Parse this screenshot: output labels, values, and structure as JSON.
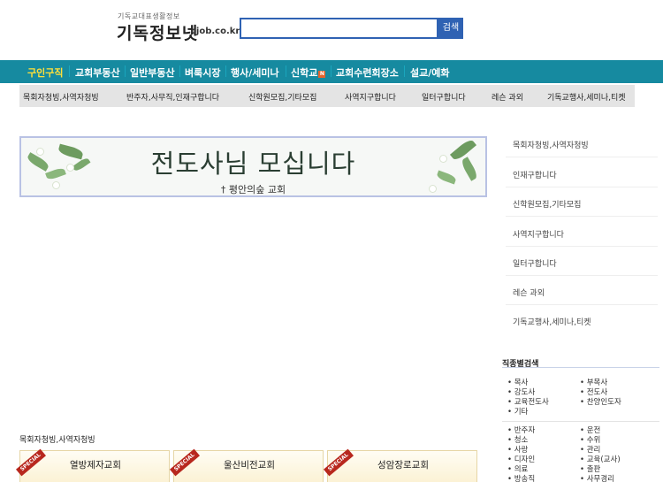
{
  "header": {
    "tagline": "기독교대표생활정보",
    "logo": "기독정보넷",
    "domain": "cjob.co.kr",
    "search": {
      "value": "",
      "button": "검색"
    }
  },
  "nav": {
    "items": [
      {
        "label": "구인구직",
        "active": true
      },
      {
        "label": "교회부동산"
      },
      {
        "label": "일반부동산"
      },
      {
        "label": "벼룩시장"
      },
      {
        "label": "행사/세미나"
      },
      {
        "label": "신학교",
        "badge": "N"
      },
      {
        "label": "교회수련회장소"
      },
      {
        "label": "설교/예화"
      }
    ]
  },
  "subnav": {
    "items": [
      "목회자청빙,사역자청빙",
      "반주자,사무직,인재구합니다",
      "신학원모집,기타모집",
      "사역지구합니다",
      "일터구합니다",
      "레슨 과외",
      "기독교행사,세미나,티켓"
    ]
  },
  "banner": {
    "title": "전도사님 모십니다",
    "subtitle": "† 평안의숲 교회"
  },
  "sidebar": {
    "items": [
      "목회자청빙,사역자청빙",
      "인재구합니다",
      "신학원모집,기타모집",
      "사역지구합니다",
      "일터구합니다",
      "레슨 과외",
      "기독교행사,세미나,티켓"
    ],
    "job_search": {
      "title": "직종별검색",
      "group1": [
        "목사",
        "부목사",
        "강도사",
        "전도사",
        "교육전도사",
        "찬양인도자",
        "기타"
      ],
      "group2": [
        "반주자",
        "운전",
        "청소",
        "수위",
        "사랑",
        "관리",
        "디자인",
        "교육(교사)",
        "의료",
        "출판",
        "방송직",
        "사무경리"
      ]
    }
  },
  "listing": {
    "title": "목회자청빙,사역자청빙",
    "badge": "SPECIAL",
    "cards": [
      "열방제자교회",
      "울산비전교회",
      "성암장로교회"
    ]
  },
  "colors": {
    "nav_bg": "#168aa0",
    "nav_active": "#ffe03a",
    "search_blue": "#2f62b3",
    "subnav_bg": "#e4e4e4",
    "ribbon": "#b8281e"
  }
}
